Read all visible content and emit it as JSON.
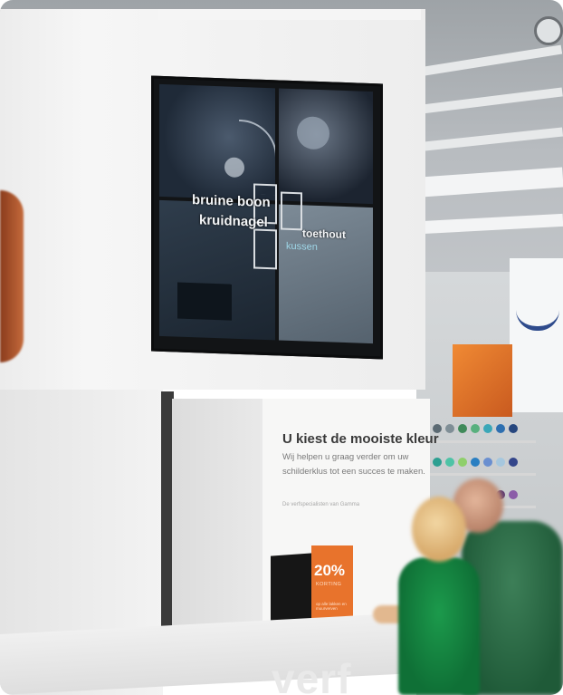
{
  "video_wall": {
    "labels": [
      "bruine boon",
      "kruidnagel",
      "toethout",
      "kussen"
    ]
  },
  "info_panel": {
    "headline": "U kiest de mooiste kleur",
    "body_line1": "Wij helpen u graag verder om uw",
    "body_line2": "schilderklus tot een succes te maken.",
    "small_note": "De verfspecialisten van Gamma"
  },
  "promo_sign": {
    "percent": "20%",
    "label": "KORTING",
    "fine_print": "op alle lakken en muurverven"
  },
  "counter": {
    "word": "verf"
  },
  "colors": {
    "promo_orange": "#e8732c",
    "shirt_green": "#1c9a4c",
    "wall_white": "#f2f2f2",
    "screen_dark": "#121416"
  }
}
